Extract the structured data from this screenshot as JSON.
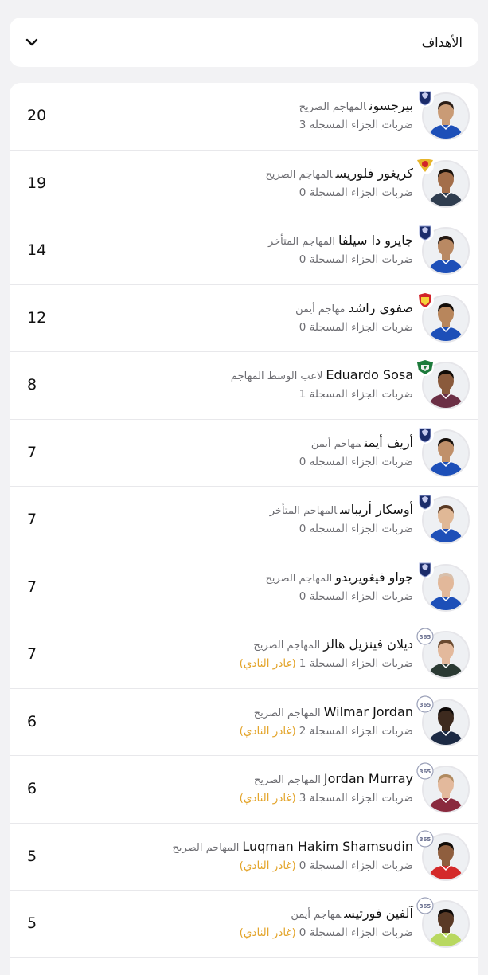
{
  "filter": {
    "label": "الأهداف"
  },
  "players": [
    {
      "name": "بيرجسون",
      "position": "المهاجم الصريح",
      "penalties": "ضربات الجزاء المسجلة 3",
      "left_club": "",
      "goals": "20",
      "team_logo": "jdt-crest-icon",
      "jersey": "#1d4fb8",
      "skin": "#c99b76",
      "hair": "#2a1d16"
    },
    {
      "name": "كريغور فلوريس",
      "position": "المهاجم الصريح",
      "penalties": "ضربات الجزاء المسجلة 0",
      "left_club": "",
      "goals": "19",
      "team_logo": "selangor-crest-icon",
      "jersey": "#2f3d4f",
      "skin": "#a36e4a",
      "hair": "#1a120c"
    },
    {
      "name": "جايرو دا سيلفا",
      "position": "المهاجم المتأخر",
      "penalties": "ضربات الجزاء المسجلة 0",
      "left_club": "",
      "goals": "14",
      "team_logo": "jdt-crest-icon",
      "jersey": "#1d4fb8",
      "skin": "#b98963",
      "hair": "#241812"
    },
    {
      "name": "صفوي راشد",
      "position": "مهاجم أيمن",
      "penalties": "ضربات الجزاء المسجلة 0",
      "left_club": "",
      "goals": "12",
      "team_logo": "kedah-crest-icon",
      "jersey": "#1d4fb8",
      "skin": "#b8865c",
      "hair": "#140e0a"
    },
    {
      "name": "Eduardo Sosa",
      "position": "لاعب الوسط المهاجم",
      "penalties": "ضربات الجزاء المسجلة 1",
      "left_club": "",
      "goals": "8",
      "team_logo": "terengganu-crest-icon",
      "jersey": "#6b2f45",
      "skin": "#8a5a3c",
      "hair": "#120c08"
    },
    {
      "name": "أريف أيمن",
      "position": "مهاجم أيمن",
      "penalties": "ضربات الجزاء المسجلة 0",
      "left_club": "",
      "goals": "7",
      "team_logo": "jdt-crest-icon",
      "jersey": "#1d4fb8",
      "skin": "#c0906a",
      "hair": "#16100c"
    },
    {
      "name": "أوسكار أريباس",
      "position": "المهاجم المتأخر",
      "penalties": "ضربات الجزاء المسجلة 0",
      "left_club": "",
      "goals": "7",
      "team_logo": "jdt-crest-icon",
      "jersey": "#1d4fb8",
      "skin": "#e0b896",
      "hair": "#5a3a24"
    },
    {
      "name": "جواو فيغويريدو",
      "position": "المهاجم الصريح",
      "penalties": "ضربات الجزاء المسجلة 0",
      "left_club": "",
      "goals": "7",
      "team_logo": "jdt-crest-icon",
      "jersey": "#1d4fb8",
      "skin": "#e2b89a",
      "hair": "#d8c0ac"
    },
    {
      "name": "ديلان فينزيل هالز",
      "position": "المهاجم الصريح",
      "penalties": "ضربات الجزاء المسجلة 1",
      "left_club": "(غادر النادي)",
      "goals": "7",
      "team_logo": "365-badge-icon",
      "jersey": "#2b3a33",
      "skin": "#e3b99c",
      "hair": "#6a4a30"
    },
    {
      "name": "Wilmar Jordan",
      "position": "المهاجم الصريح",
      "penalties": "ضربات الجزاء المسجلة 2",
      "left_club": "(غادر النادي)",
      "goals": "6",
      "team_logo": "365-badge-icon",
      "jersey": "#1c2a44",
      "skin": "#3d2a1e",
      "hair": "#0e0a08"
    },
    {
      "name": "Jordan Murray",
      "position": "المهاجم الصريح",
      "penalties": "ضربات الجزاء المسجلة 3",
      "left_club": "(غادر النادي)",
      "goals": "6",
      "team_logo": "365-badge-icon",
      "jersey": "#8a2a3e",
      "skin": "#e3b99c",
      "hair": "#b08a60"
    },
    {
      "name": "Luqman Hakim Shamsudin",
      "position": "المهاجم الصريح",
      "penalties": "ضربات الجزاء المسجلة 0",
      "left_club": "(غادر النادي)",
      "goals": "5",
      "team_logo": "365-badge-icon",
      "jersey": "#d42a2a",
      "skin": "#8f5e3e",
      "hair": "#120c08"
    },
    {
      "name": "آلفين فورتيس",
      "position": "مهاجم أيمن",
      "penalties": "ضربات الجزاء المسجلة 0",
      "left_club": "(غادر النادي)",
      "goals": "5",
      "team_logo": "365-badge-icon",
      "jersey": "#b8d860",
      "skin": "#5a3a26",
      "hair": "#0e0a08"
    }
  ]
}
